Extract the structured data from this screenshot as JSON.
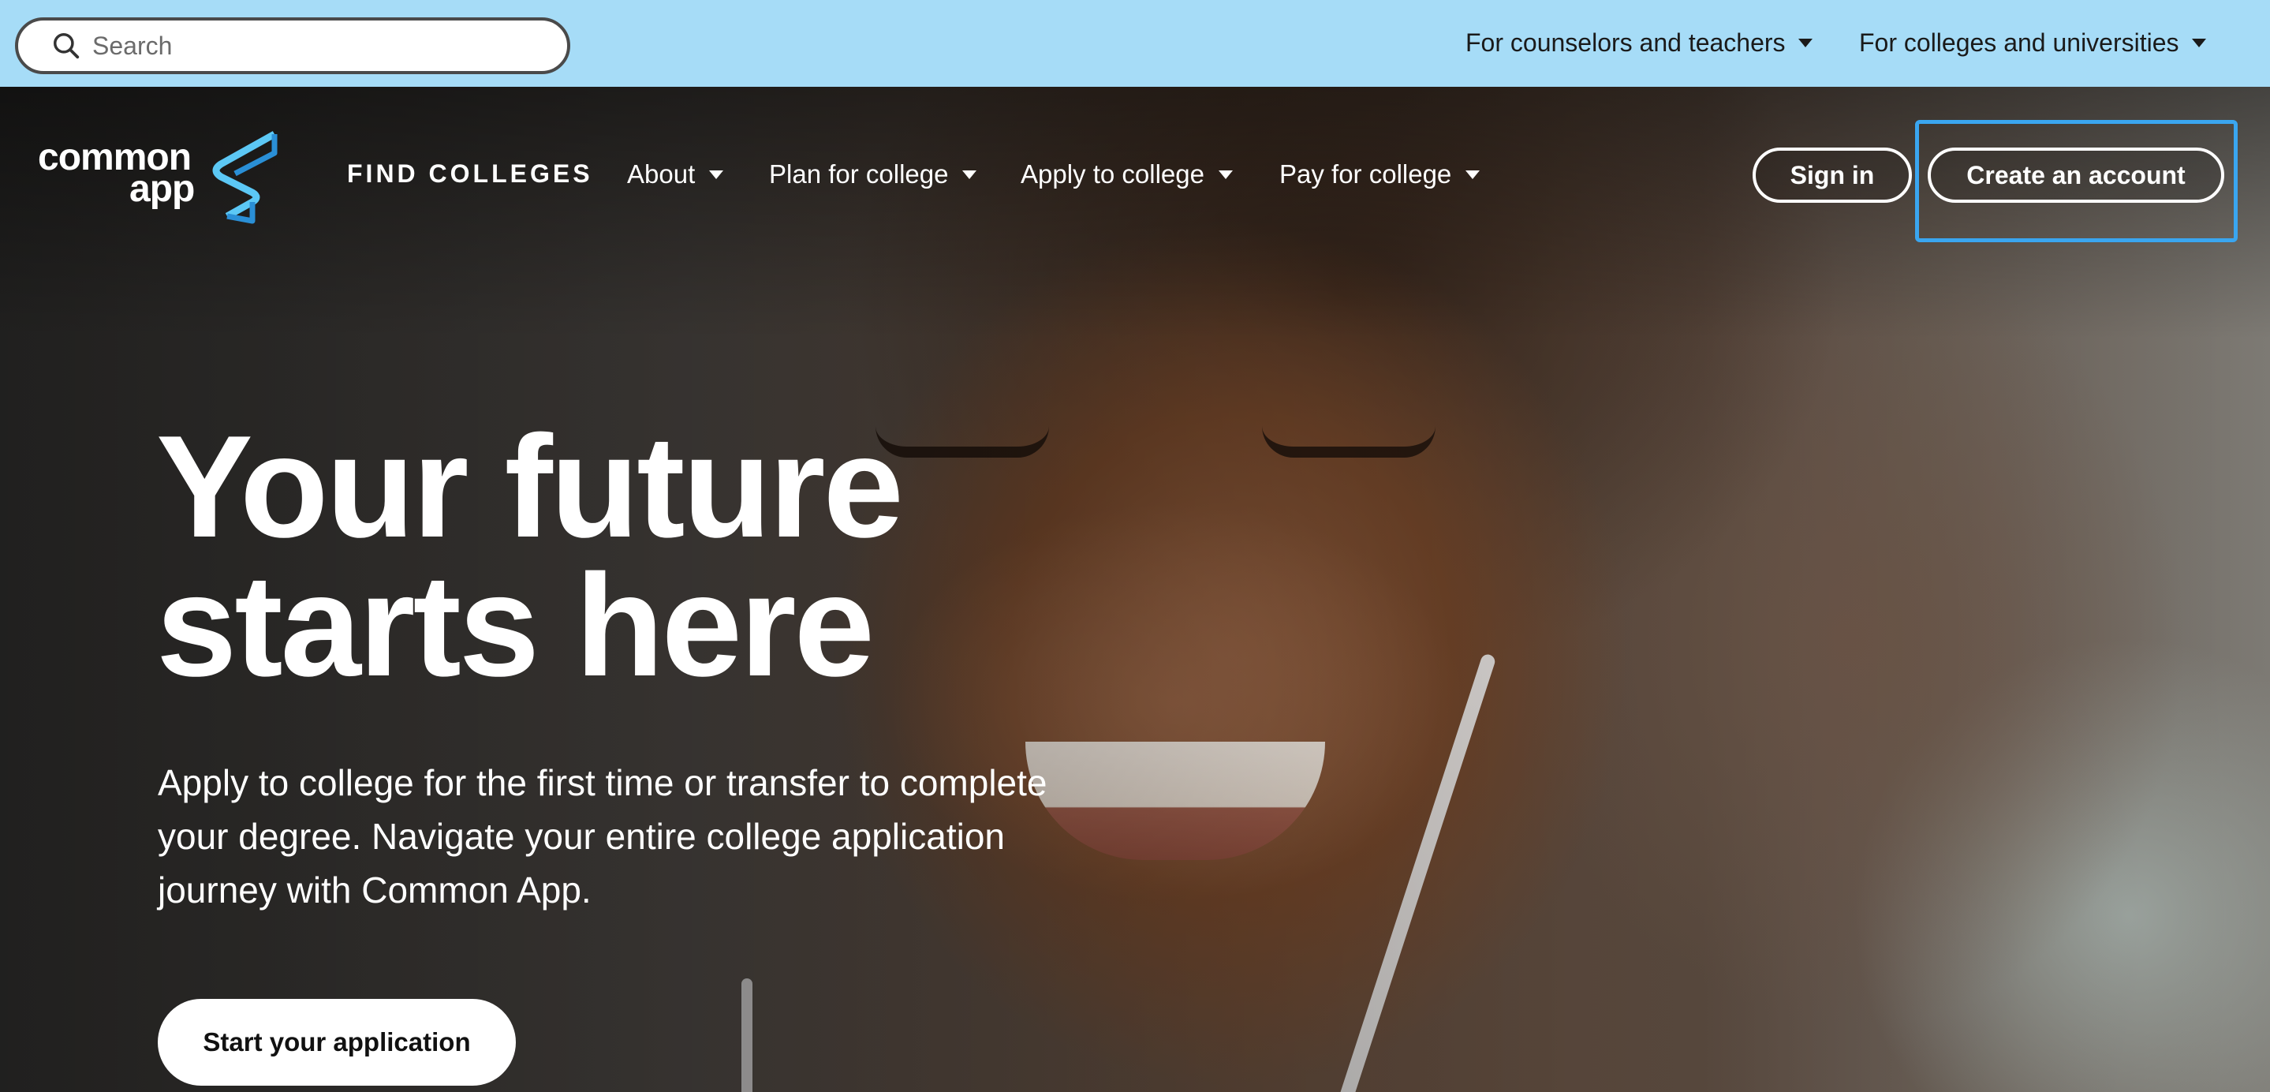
{
  "search": {
    "placeholder": "Search",
    "icon": "search-icon"
  },
  "utility_nav": [
    {
      "label": "For counselors and teachers",
      "icon": "caret-down-icon"
    },
    {
      "label": "For colleges and universities",
      "icon": "caret-down-icon"
    }
  ],
  "logo": {
    "line1": "common",
    "line2": "app",
    "mark_colors": [
      "#5cc8f5",
      "#2a8fd6"
    ]
  },
  "main_nav": {
    "find_colleges": "FIND COLLEGES",
    "items": [
      {
        "label": "About",
        "icon": "caret-down-icon"
      },
      {
        "label": "Plan for college",
        "icon": "caret-down-icon"
      },
      {
        "label": "Apply to college",
        "icon": "caret-down-icon"
      },
      {
        "label": "Pay for college",
        "icon": "caret-down-icon"
      }
    ],
    "sign_in": "Sign in",
    "create_account": "Create an account"
  },
  "hero": {
    "title_line1": "Your future",
    "title_line2": "starts here",
    "subtitle": "Apply to college for the first time or transfer to complete your degree. Navigate your entire college application journey with Common App.",
    "cta": "Start your application"
  },
  "colors": {
    "utility_bar": "#a6dcf7",
    "focus_ring": "#3aa6f0",
    "text_on_hero": "#ffffff"
  }
}
